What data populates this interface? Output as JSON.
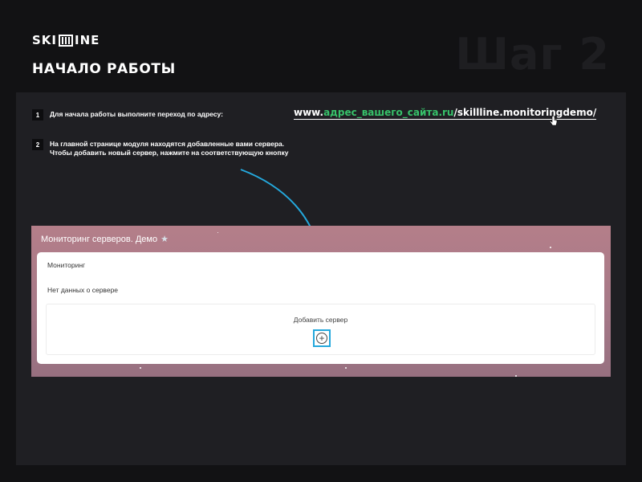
{
  "brand": {
    "logo_left": "SKI",
    "logo_right": "INE"
  },
  "heading": "НАЧАЛО РАБОТЫ",
  "step_badge": "Шаг 2",
  "steps": [
    {
      "number": "1",
      "text": "Для начала работы выполните переход по адресу:"
    },
    {
      "number": "2",
      "text": "На главной странице модуля находятся добавленные вами сервера. Чтобы добавить новый сервер, нажмите на соответствующую кнопку"
    }
  ],
  "url": {
    "prefix": "www.",
    "placeholder": "адрес_вашего_сайта.ru",
    "path": "/skillline.monitoringdemo/"
  },
  "app": {
    "title": "Мониторинг серверов. Демо",
    "card_title": "Мониторинг",
    "empty_message": "Нет данных о сервере",
    "add_label": "Добавить сервер"
  },
  "colors": {
    "background": "#121214",
    "panel": "#1f1f23",
    "accent_green": "#37c26a",
    "arrow_blue": "#24a8dc",
    "app_bg": "#b47e89"
  },
  "icons": {
    "star": "star-icon",
    "add": "plus-circle-icon",
    "cursor": "hand-cursor-icon",
    "arrow": "curved-arrow-icon"
  }
}
